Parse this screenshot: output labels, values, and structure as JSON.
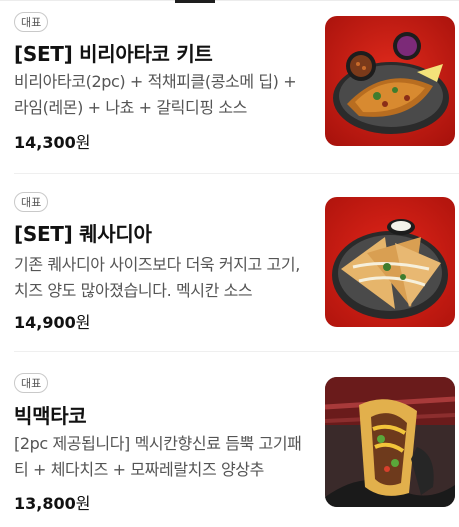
{
  "menu_items": [
    {
      "badge": "대표",
      "name": "[SET] 비리아타코 키트",
      "description": "비리아타코(2pc) + 적채피클(콩소메 딥) + 라임(레몬) + 나쵸 + 갈릭디핑 소스",
      "price": "14,300",
      "currency": "원",
      "photo_icon": "birria-taco-kit-photo"
    },
    {
      "badge": "대표",
      "name": "[SET] 퀘사디아",
      "description": "기존 퀘사디아 사이즈보다 더욱 커지고 고기,치즈 양도 많아졌습니다. 멕시칸 소스",
      "price": "14,900",
      "currency": "원",
      "photo_icon": "quesadilla-photo"
    },
    {
      "badge": "대표",
      "name": "빅맥타코",
      "description": "[2pc 제공됩니다] 멕시칸향신료 듬뿍 고기패티 + 체다치즈 + 모짜레랄치즈 양상추",
      "price": "13,800",
      "currency": "원",
      "photo_icon": "bigmac-taco-photo"
    }
  ],
  "colors": {
    "red_background": "#c81a12",
    "price_text": "#111111",
    "badge_border": "#c9c9c9"
  }
}
